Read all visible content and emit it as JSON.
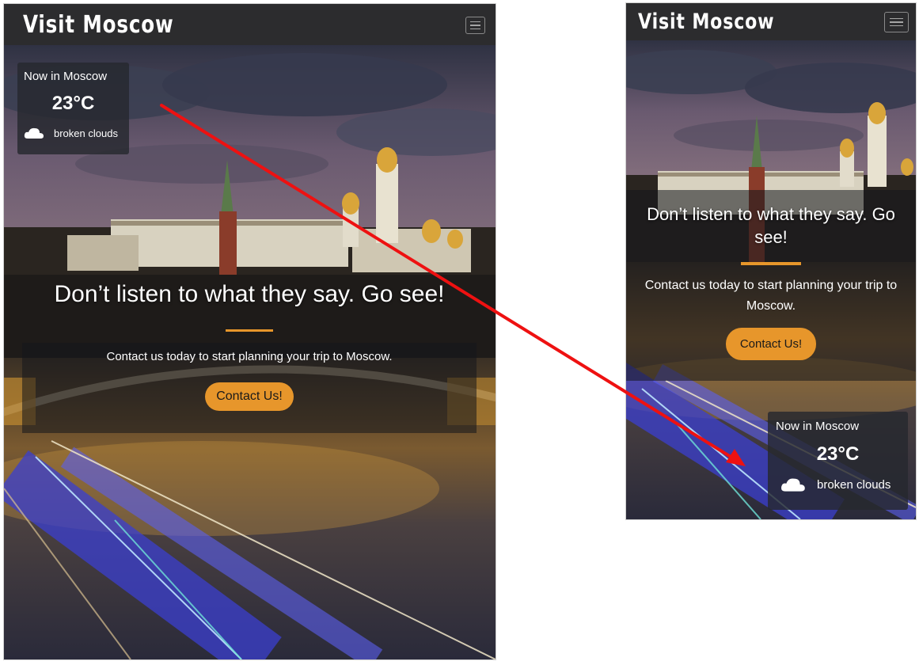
{
  "brand": "Visit Moscow",
  "weather": {
    "title": "Now in Moscow",
    "temperature": "23°C",
    "description": "broken clouds",
    "icon": "cloud-icon"
  },
  "hero": {
    "headline": "Don’t listen to what they say. Go see!",
    "subtext": "Contact us today to start planning your trip to Moscow.",
    "cta_label": "Contact Us!"
  },
  "navbar": {
    "toggler_icon": "hamburger-menu-icon"
  },
  "colors": {
    "navbar": "#2c2c2e",
    "accent": "#e7962b",
    "annotation_arrow": "#ee1111"
  }
}
